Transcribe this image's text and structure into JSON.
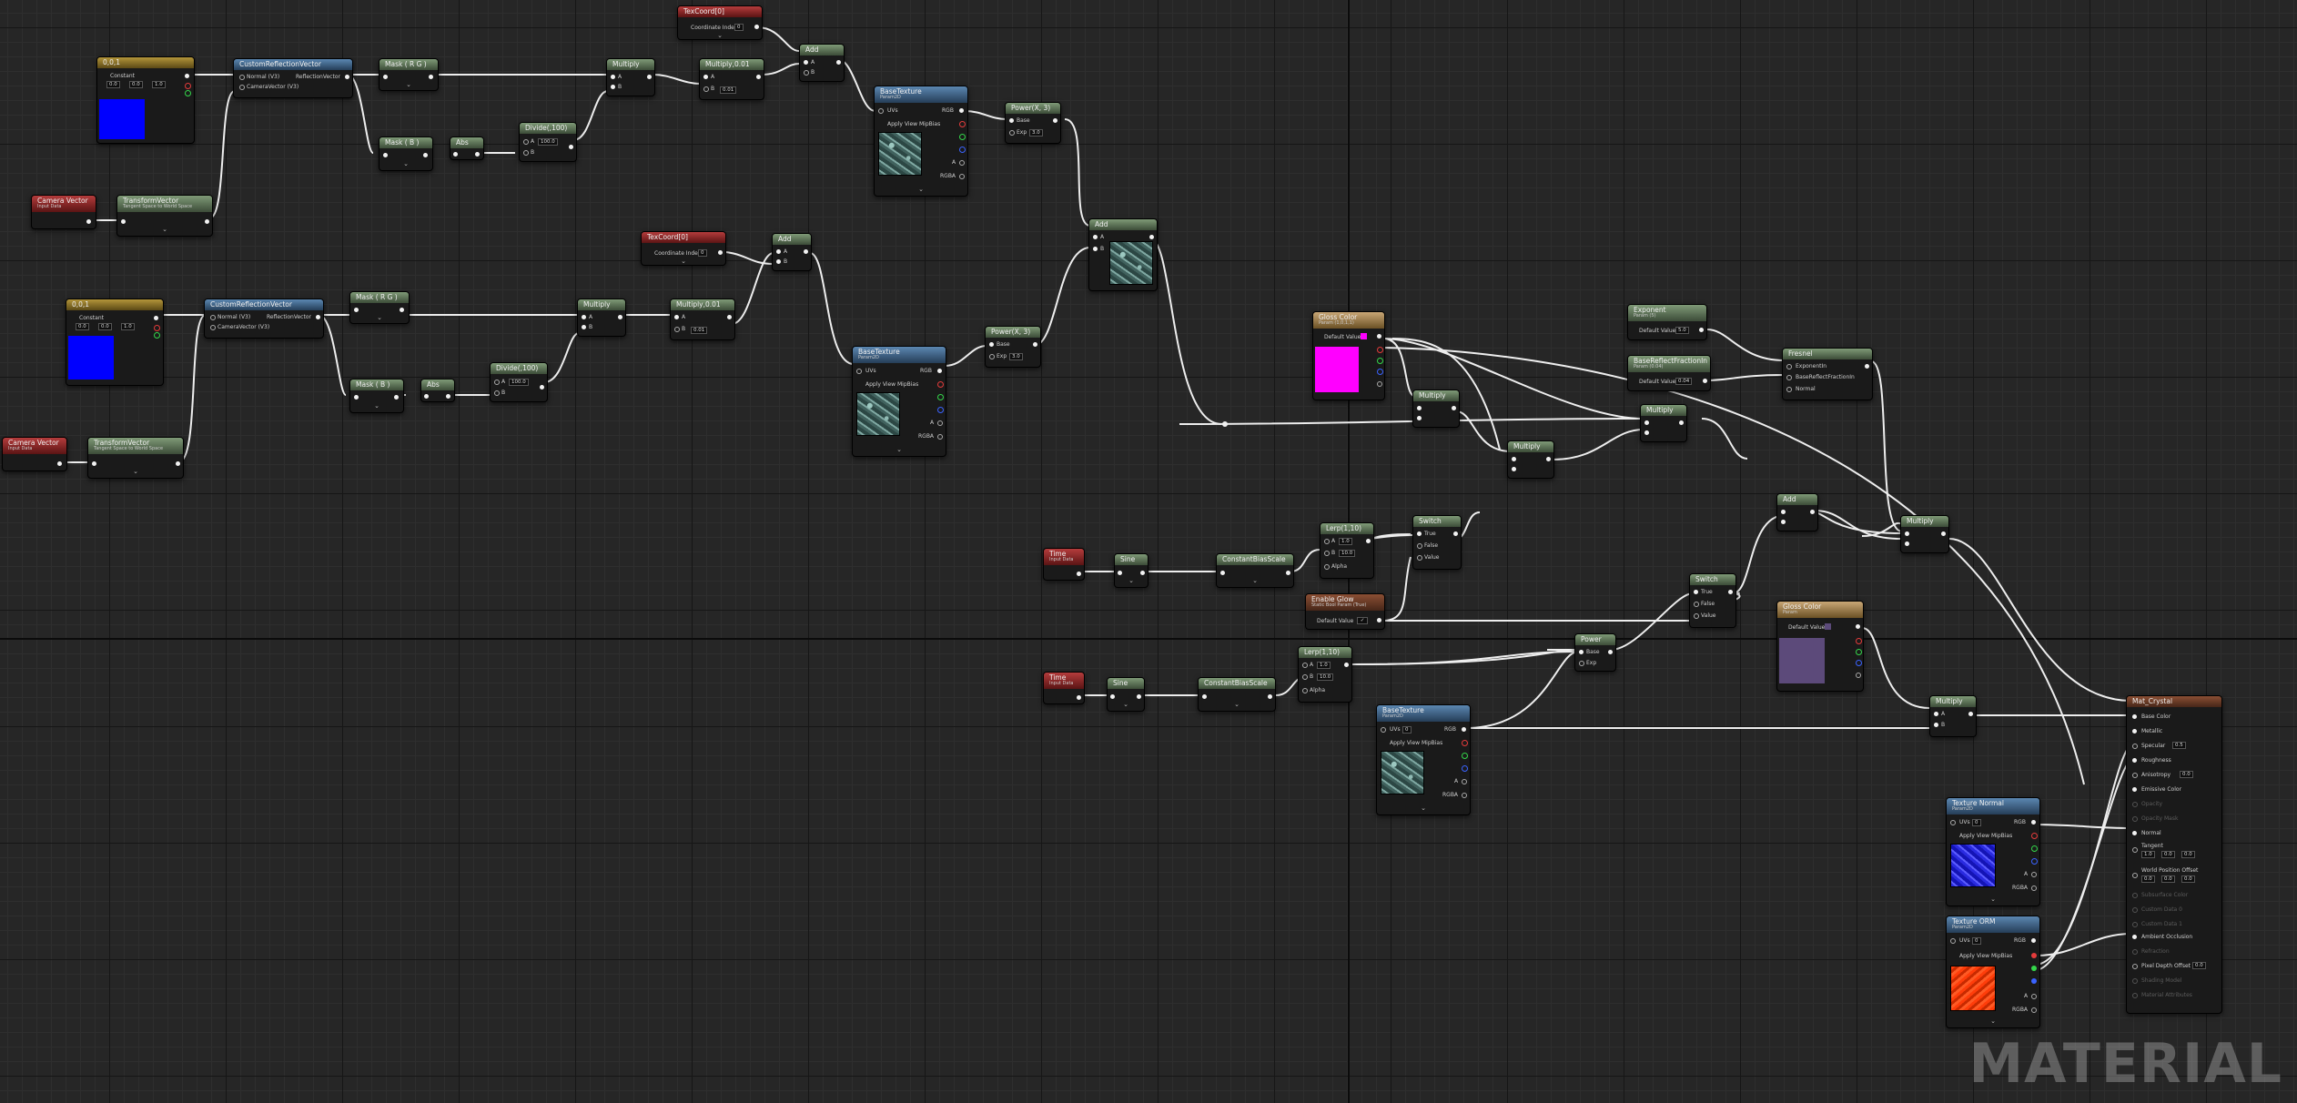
{
  "watermark": "MATERIAL",
  "colors": {
    "background": "#262626",
    "wire": "#eeeeee",
    "param_magenta": "#ff00ff",
    "param_purple": "#5c4a7a",
    "blue_const": "#0000ff"
  },
  "nodes": {
    "const_top": {
      "title": "0,0,1",
      "sub_label": "Constant",
      "values": [
        "0.0",
        "0.0",
        "1.0"
      ]
    },
    "custom_reflect_top": {
      "title": "CustomReflectionVector",
      "in1": "Normal (V3)",
      "in2": "CameraVector (V3)",
      "out": "ReflectionVector"
    },
    "mask_rg_top": {
      "title": "Mask ( R G )"
    },
    "multiply_top": {
      "title": "Multiply",
      "a": "A",
      "b": "B"
    },
    "multiply_001_top": {
      "title": "Multiply,0.01",
      "a": "A",
      "b": "0.01"
    },
    "mask_b_top": {
      "title": "Mask ( B )"
    },
    "abs_top": {
      "title": "Abs"
    },
    "divide_top": {
      "title": "Divide(,100)",
      "a": "A",
      "b": "100.0"
    },
    "tex_coord_top": {
      "title": "TexCoord[0]",
      "field": "Coordinate Index",
      "value": "0"
    },
    "add_top1": {
      "title": "Add",
      "a": "A",
      "b": "B"
    },
    "basetex_top": {
      "title": "BaseTexture",
      "sub": "Param2D",
      "uv": "UVs",
      "apply": "Apply View MipBias",
      "outs": [
        "RGB",
        "R",
        "G",
        "B",
        "A",
        "RGBA"
      ]
    },
    "power_top": {
      "title": "Power(X, 3)",
      "a": "Base",
      "b": "Exp",
      "exp_val": "3.0"
    },
    "cam_vec_top": {
      "title": "Camera Vector",
      "sub": "Input Data"
    },
    "transform_top": {
      "title": "TransformVector",
      "sub": "Tangent Space to World Space"
    },
    "add_mid": {
      "title": "Add",
      "a": "A",
      "b": "B"
    },
    "tex_coord_mid": {
      "title": "TexCoord[0]",
      "field": "Coordinate Index",
      "value": "0"
    },
    "add_mid2": {
      "title": "Add",
      "a": "A",
      "b": "B"
    },
    "const_mid": {
      "title": "0,0,1",
      "sub_label": "Constant",
      "values": [
        "0.0",
        "0.0",
        "1.0"
      ]
    },
    "custom_reflect_mid": {
      "title": "CustomReflectionVector",
      "in1": "Normal (V3)",
      "in2": "CameraVector (V3)",
      "out": "ReflectionVector"
    },
    "mask_rg_mid": {
      "title": "Mask ( R G )"
    },
    "multiply_mid": {
      "title": "Multiply",
      "a": "A",
      "b": "B"
    },
    "multiply_001_mid": {
      "title": "Multiply,0.01",
      "a": "A",
      "b": "0.01"
    },
    "mask_b_mid": {
      "title": "Mask ( B )"
    },
    "abs_mid": {
      "title": "Abs"
    },
    "divide_mid": {
      "title": "Divide(,100)",
      "a": "A",
      "b": "100.0"
    },
    "basetex_mid": {
      "title": "BaseTexture",
      "sub": "Param2D",
      "uv": "UVs",
      "apply": "Apply View MipBias",
      "outs": [
        "RGB",
        "R",
        "G",
        "B",
        "A",
        "RGBA"
      ]
    },
    "power_mid": {
      "title": "Power(X, 3)",
      "a": "Base",
      "b": "Exp",
      "exp_val": "3.0"
    },
    "cam_vec_mid": {
      "title": "Camera Vector",
      "sub": "Input Data"
    },
    "transform_mid": {
      "title": "TransformVector",
      "sub": "Tangent Space to World Space"
    },
    "param_color1": {
      "title": "Gloss Color",
      "sub": "Param (1,0,1,1)",
      "field": "Default Value"
    },
    "multiply_a": {
      "title": "Multiply"
    },
    "multiply_b": {
      "title": "Multiply"
    },
    "multiply_c": {
      "title": "Multiply"
    },
    "exponent": {
      "title": "Exponent",
      "sub": "Param (5)",
      "field": "Default Value",
      "value": "5.0"
    },
    "base_reflect": {
      "title": "BaseReflectFractionIn",
      "sub": "Param (0.04)",
      "field": "Default Value",
      "value": "0.04"
    },
    "fresnel": {
      "title": "Fresnel",
      "in1": "ExponentIn",
      "in2": "BaseReflectFractionIn",
      "in3": "Normal"
    },
    "add_right": {
      "title": "Add"
    },
    "multiply_right": {
      "title": "Multiply"
    },
    "time1": {
      "title": "Time",
      "sub": "Input Data"
    },
    "sine1": {
      "title": "Sine"
    },
    "const_bias1": {
      "title": "ConstantBiasScale"
    },
    "lerp1": {
      "title": "Lerp(1,10)",
      "a": "A",
      "a_val": "1.0",
      "b": "B",
      "b_val": "10.0",
      "alpha": "Alpha"
    },
    "switch1": {
      "title": "Switch",
      "t": "True",
      "f": "False",
      "v": "Value"
    },
    "enable_glow": {
      "title": "Enable Glow",
      "sub": "Static Bool Param (True)",
      "field": "Default Value"
    },
    "switch2": {
      "title": "Switch",
      "t": "True",
      "f": "False",
      "v": "Value"
    },
    "param_color2": {
      "title": "Gloss Color",
      "sub": "Param",
      "field": "Default Value"
    },
    "time2": {
      "title": "Time",
      "sub": "Input Data"
    },
    "sine2": {
      "title": "Sine"
    },
    "const_bias2": {
      "title": "ConstantBiasScale"
    },
    "lerp2": {
      "title": "Lerp(1,10)",
      "a": "A",
      "a_val": "1.0",
      "b": "B",
      "b_val": "10.0",
      "alpha": "Alpha"
    },
    "power_low": {
      "title": "Power",
      "a": "Base",
      "b": "Exp"
    },
    "basetex_low": {
      "title": "BaseTexture",
      "sub": "Param2D",
      "uv": "UVs",
      "uv_val": "0",
      "apply": "Apply View MipBias",
      "outs": [
        "RGB",
        "R",
        "G",
        "B",
        "A",
        "RGBA"
      ]
    },
    "multiply_low": {
      "title": "Multiply",
      "a": "A",
      "b": "B"
    },
    "tex_normal": {
      "title": "Texture Normal",
      "sub": "Param2D",
      "uv": "UVs",
      "uv_val": "0",
      "apply": "Apply View MipBias",
      "outs": [
        "RGB",
        "R",
        "G",
        "B",
        "A",
        "RGBA"
      ]
    },
    "tex_orm": {
      "title": "Texture ORM",
      "sub": "Param2D",
      "uv": "UVs",
      "uv_val": "0",
      "apply": "Apply View MipBias",
      "outs": [
        "RGB",
        "R",
        "G",
        "B",
        "A",
        "RGBA"
      ]
    },
    "result": {
      "title": "Mat_Crystal",
      "pins": [
        "Base Color",
        "Metallic",
        "Specular",
        "Roughness",
        "Anisotropy",
        "Emissive Color",
        "Opacity",
        "Opacity Mask",
        "Normal",
        "Tangent",
        "World Position Offset",
        "Subsurface Color",
        "Custom Data 0",
        "Custom Data 1",
        "Ambient Occlusion",
        "Refraction",
        "Pixel Depth Offset",
        "Shading Model",
        "Material Attributes"
      ],
      "specular_val": "0.5",
      "anisotropy_val": "0.0",
      "tangent_vals": [
        "1.0",
        "0.0",
        "0.0"
      ],
      "wpo_vals": [
        "0.0",
        "0.0",
        "0.0"
      ],
      "pdo_val": "0.0"
    }
  }
}
